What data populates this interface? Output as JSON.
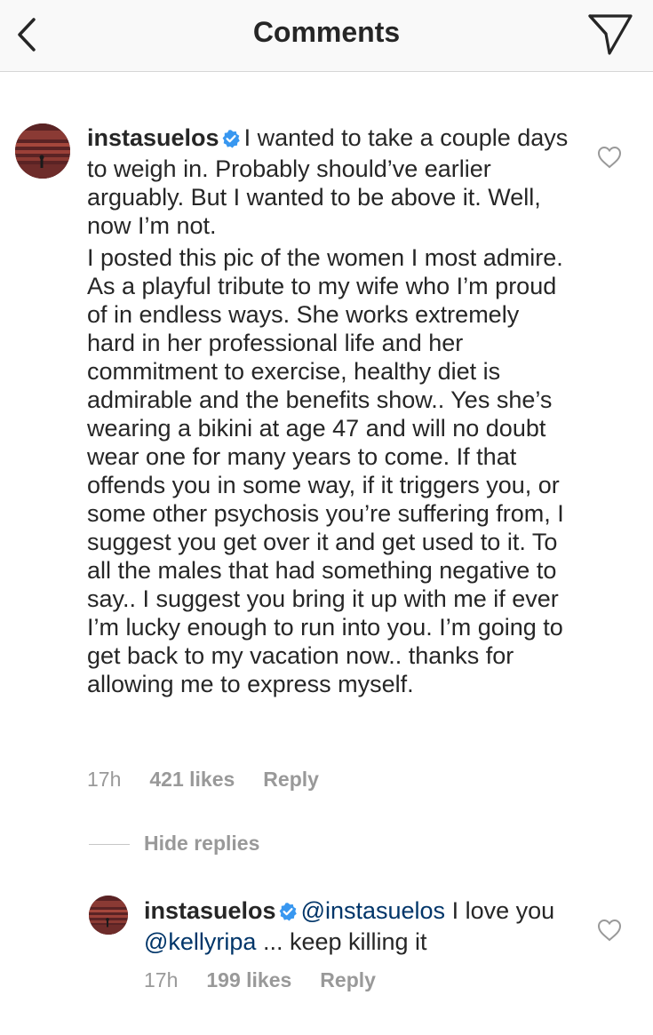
{
  "header": {
    "title": "Comments",
    "back_icon": "chevron-left-icon",
    "send_icon": "paper-plane-icon"
  },
  "colors": {
    "text": "#262626",
    "meta": "#999999",
    "mention": "#003569",
    "verified": "#3897f0",
    "header_bg": "#f9f9f9"
  },
  "comment": {
    "username": "instasuelos",
    "verified": true,
    "text_p1": "I wanted to take a couple days to weigh in. Probably should’ve earlier arguably. But I wanted to be above it.  Well, now I’m not.",
    "text_p2": "I posted this pic of the women I most admire.  As a playful tribute to my wife who I’m proud of in endless ways.  She works extremely hard in her professional life and her  commitment  to exercise, healthy diet is admirable and the benefits show.. Yes she’s wearing a bikini at age 47 and will no doubt wear one for many years to come.  If that offends you in some way, if it triggers you, or some other psychosis you’re suffering from, I suggest you get over it and get used to it.  To all the males that had something negative to say.. I suggest you bring it up with me if ever I’m lucky enough to run into you.  I’m going to get back to my vacation now.. thanks for allowing me to express myself.",
    "time": "17h",
    "likes": "421 likes",
    "reply": "Reply"
  },
  "hide_replies": "Hide replies",
  "reply_comment": {
    "username": "instasuelos",
    "verified": true,
    "mention1": "@instasuelos",
    "text1": " I love you ",
    "mention2": "@kellyripa",
    "text2": " ... keep killing it",
    "time": "17h",
    "likes": "199 likes",
    "reply": "Reply"
  }
}
